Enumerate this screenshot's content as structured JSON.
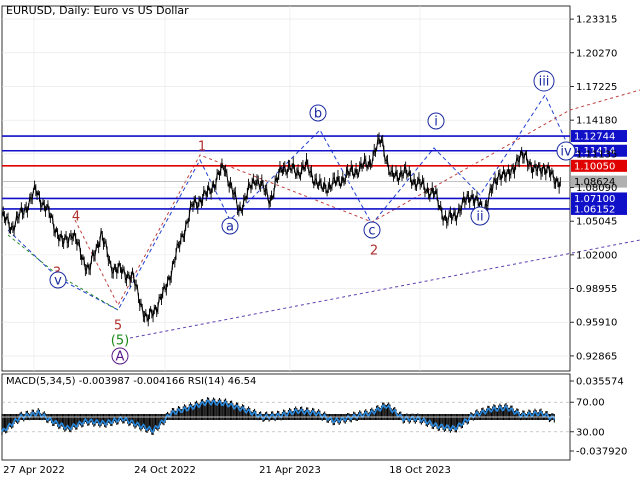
{
  "header": {
    "symbol": "EURUSD",
    "timeframe": "Daily",
    "description": "Euro vs US Dollar"
  },
  "indicator_header": {
    "macd": "MACD(5,34,5) -0.003987 -0.004166",
    "rsi": "RSI(14) 46.54"
  },
  "chart_data": {
    "type": "line",
    "main_axis": {
      "ticks": [
        "1.23315",
        "1.20270",
        "1.17225",
        "1.14180",
        "1.11135",
        "1.08090",
        "1.05045",
        "1.02000",
        "0.98955",
        "0.95910",
        "0.92865"
      ],
      "ylim": [
        0.915,
        1.245
      ]
    },
    "x_labels": [
      "27 Apr 2022",
      "24 Oct 2022",
      "21 Apr 2023",
      "18 Oct 2023"
    ],
    "price_series": {
      "name": "EURUSD",
      "x_index": [
        0,
        8,
        18,
        28,
        40,
        50,
        58,
        72,
        82,
        90,
        108,
        120,
        134,
        150,
        158,
        170,
        184,
        196,
        210,
        222,
        232,
        244,
        252,
        264,
        276,
        290,
        304,
        314,
        322,
        332,
        344,
        358,
        368,
        378,
        388,
        398,
        406,
        412,
        418,
        426,
        434,
        440,
        448,
        456,
        462
      ],
      "values": [
        1.055,
        1.045,
        1.06,
        1.078,
        1.055,
        1.03,
        1.04,
        1.005,
        1.04,
        1.01,
        1.0,
        0.96,
        0.985,
        1.04,
        1.065,
        1.075,
        1.1,
        1.06,
        1.09,
        1.07,
        1.1,
        1.095,
        1.1,
        1.08,
        1.085,
        1.095,
        1.103,
        1.125,
        1.09,
        1.095,
        1.085,
        1.075,
        1.05,
        1.06,
        1.075,
        1.06,
        1.08,
        1.095,
        1.09,
        1.105,
        1.11,
        1.095,
        1.1,
        1.09,
        1.086
      ]
    },
    "horizontal_levels": [
      {
        "value": 1.12744,
        "label": "1.12744",
        "color": "#1010c8"
      },
      {
        "value": 1.11414,
        "label": "1.11414",
        "color": "#1010c8"
      },
      {
        "value": 1.1005,
        "label": "1.10050",
        "color": "#e00000"
      },
      {
        "value": 1.08624,
        "label": "1.08624",
        "color": "#b0b0b0"
      },
      {
        "value": 1.071,
        "label": "1.07100",
        "color": "#1010c8"
      },
      {
        "value": 1.06152,
        "label": "1.06152",
        "color": "#1010c8"
      }
    ],
    "wave_labels": [
      {
        "text": "1",
        "color": "#b03030",
        "circled": false
      },
      {
        "text": "2",
        "color": "#b03030",
        "circled": false
      },
      {
        "text": "3",
        "color": "#b03030",
        "circled": false
      },
      {
        "text": "4",
        "color": "#b03030",
        "circled": false
      },
      {
        "text": "5",
        "color": "#b03030",
        "circled": false
      },
      {
        "text": "(5)",
        "color": "#1a8a1a",
        "circled": false
      },
      {
        "text": "A",
        "color": "#5a1a8a",
        "circled": true
      },
      {
        "text": "v",
        "color": "#1a2aa0",
        "circled": true
      },
      {
        "text": "a",
        "color": "#1a2aa0",
        "circled": true
      },
      {
        "text": "b",
        "color": "#1a2aa0",
        "circled": true
      },
      {
        "text": "c",
        "color": "#1a2aa0",
        "circled": true
      },
      {
        "text": "i",
        "color": "#1a2aa0",
        "circled": true
      },
      {
        "text": "ii",
        "color": "#1a2aa0",
        "circled": true
      },
      {
        "text": "iii",
        "color": "#1a2aa0",
        "circled": true
      },
      {
        "text": "iv",
        "color": "#1a2aa0",
        "circled": true
      }
    ],
    "indicator_axis": {
      "ticks": [
        "0.035574",
        "70.00",
        "30.00",
        "-0.037920"
      ],
      "rsi_levels": [
        70,
        30
      ]
    },
    "rsi_series": {
      "name": "RSI(14)",
      "x_index": [
        0,
        15,
        30,
        45,
        55,
        70,
        85,
        100,
        112,
        125,
        140,
        155,
        170,
        185,
        200,
        215,
        230,
        245,
        260,
        275,
        290,
        305,
        318,
        332,
        345,
        360,
        375,
        390,
        405,
        418,
        430,
        445,
        458
      ],
      "values": [
        30,
        50,
        55,
        42,
        35,
        45,
        42,
        48,
        40,
        32,
        55,
        62,
        70,
        68,
        60,
        50,
        52,
        58,
        55,
        45,
        50,
        55,
        65,
        48,
        48,
        38,
        35,
        52,
        60,
        62,
        52,
        55,
        47
      ]
    },
    "grid": true
  }
}
